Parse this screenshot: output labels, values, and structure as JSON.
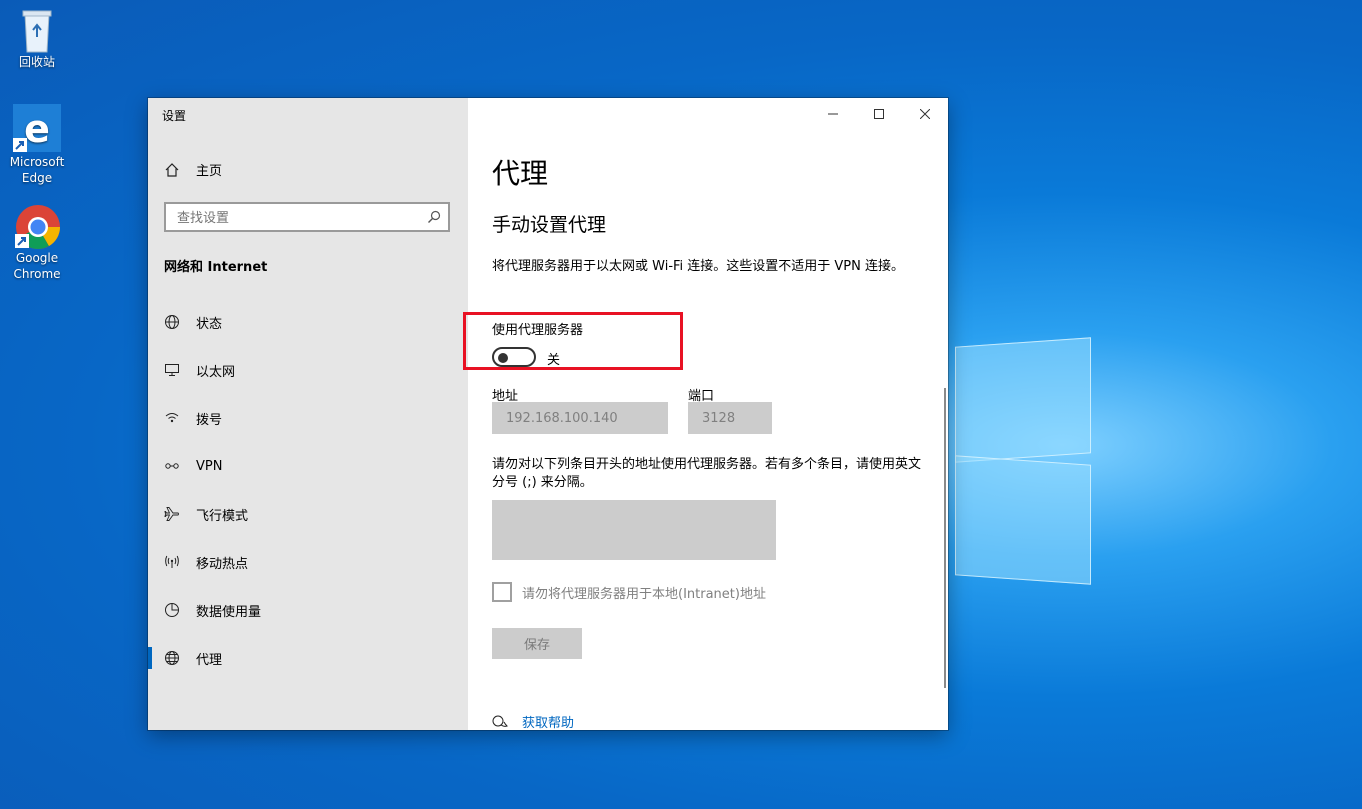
{
  "desktop": {
    "icons": [
      {
        "label": "回收站",
        "icon": "recycle-bin-icon"
      },
      {
        "label": "Microsoft Edge",
        "icon": "edge-icon"
      },
      {
        "label": "Google Chrome",
        "icon": "chrome-icon"
      }
    ]
  },
  "window": {
    "title": "设置",
    "controls": {
      "minimize": "minimize-icon",
      "maximize": "maximize-icon",
      "close": "close-icon"
    }
  },
  "sidebar": {
    "home_label": "主页",
    "search_placeholder": "查找设置",
    "section_title": "网络和 Internet",
    "items": [
      {
        "label": "状态",
        "icon": "globe-status-icon",
        "active": false
      },
      {
        "label": "以太网",
        "icon": "ethernet-icon",
        "active": false
      },
      {
        "label": "拨号",
        "icon": "dialup-icon",
        "active": false
      },
      {
        "label": "VPN",
        "icon": "vpn-icon",
        "active": false
      },
      {
        "label": "飞行模式",
        "icon": "airplane-icon",
        "active": false
      },
      {
        "label": "移动热点",
        "icon": "hotspot-icon",
        "active": false
      },
      {
        "label": "数据使用量",
        "icon": "data-usage-icon",
        "active": false
      },
      {
        "label": "代理",
        "icon": "globe-icon",
        "active": true
      }
    ]
  },
  "main": {
    "page_title": "代理",
    "section_title": "手动设置代理",
    "description": "将代理服务器用于以太网或 Wi-Fi 连接。这些设置不适用于 VPN 连接。",
    "use_proxy_label": "使用代理服务器",
    "toggle_state": "关",
    "address_label": "地址",
    "address_value": "192.168.100.140",
    "port_label": "端口",
    "port_value": "3128",
    "exceptions_desc": "请勿对以下列条目开头的地址使用代理服务器。若有多个条目，请使用英文分号 (;) 来分隔。",
    "exceptions_value": "",
    "local_checkbox_label": "请勿将代理服务器用于本地(Intranet)地址",
    "save_label": "保存",
    "help_label": "获取帮助"
  },
  "colors": {
    "accent": "#0067c0",
    "highlight": "#e81123"
  }
}
